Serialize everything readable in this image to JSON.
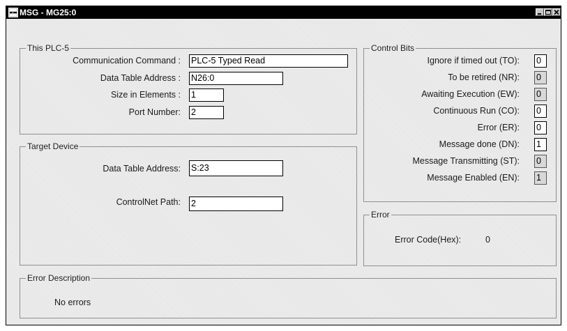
{
  "window": {
    "title": "MSG - MG25:0",
    "controls": {
      "minimize": "minimize-icon",
      "maximize": "maximize-icon",
      "close": "close-icon"
    }
  },
  "this_plc5": {
    "legend": "This PLC-5",
    "communication_command_label": "Communication Command :",
    "communication_command_value": "PLC-5 Typed Read",
    "data_table_address_label": "Data Table Address :",
    "data_table_address_value": "N26:0",
    "size_in_elements_label": "Size in Elements :",
    "size_in_elements_value": "1",
    "port_number_label": "Port Number:",
    "port_number_value": "2"
  },
  "target_device": {
    "legend": "Target Device",
    "data_table_address_label": "Data Table Address:",
    "data_table_address_value": "S:23",
    "controlnet_path_label": "ControlNet Path:",
    "controlnet_path_value": "2"
  },
  "control_bits": {
    "legend": "Control Bits",
    "items": [
      {
        "label": "Ignore if timed out (TO):",
        "value": "0",
        "editable": true
      },
      {
        "label": "To be retired (NR):",
        "value": "0",
        "editable": false
      },
      {
        "label": "Awaiting Execution (EW):",
        "value": "0",
        "editable": false
      },
      {
        "label": "Continuous Run (CO):",
        "value": "0",
        "editable": true
      },
      {
        "label": "Error (ER):",
        "value": "0",
        "editable": true
      },
      {
        "label": "Message done (DN):",
        "value": "1",
        "editable": true
      },
      {
        "label": "Message Transmitting (ST):",
        "value": "0",
        "editable": false
      },
      {
        "label": "Message Enabled (EN):",
        "value": "1",
        "editable": false
      }
    ]
  },
  "error": {
    "legend": "Error",
    "code_label": "Error Code(Hex):",
    "code_value": "0"
  },
  "error_description": {
    "legend": "Error Description",
    "text": "No errors"
  }
}
